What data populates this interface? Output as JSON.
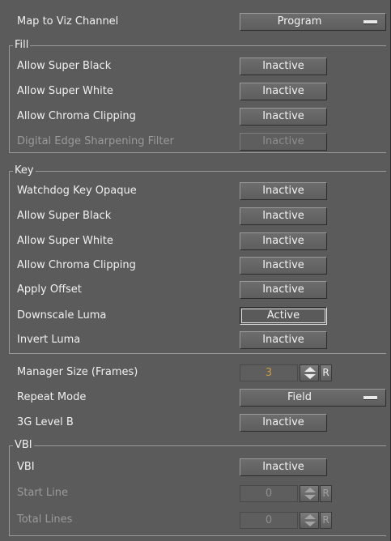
{
  "map_to_viz_channel": {
    "label": "Map to Viz Channel",
    "value": "Program"
  },
  "fill": {
    "title": "Fill",
    "items": [
      {
        "label": "Allow Super Black",
        "value": "Inactive"
      },
      {
        "label": "Allow Super White",
        "value": "Inactive"
      },
      {
        "label": "Allow Chroma Clipping",
        "value": "Inactive"
      },
      {
        "label": "Digital Edge Sharpening Filter",
        "value": "Inactive",
        "disabled": true
      }
    ]
  },
  "key": {
    "title": "Key",
    "items": [
      {
        "label": "Watchdog Key Opaque",
        "value": "Inactive"
      },
      {
        "label": "Allow Super Black",
        "value": "Inactive"
      },
      {
        "label": "Allow Super White",
        "value": "Inactive"
      },
      {
        "label": "Allow Chroma Clipping",
        "value": "Inactive"
      },
      {
        "label": "Apply Offset",
        "value": "Inactive"
      },
      {
        "label": "Downscale Luma",
        "value": "Active",
        "active": true
      },
      {
        "label": "Invert Luma",
        "value": "Inactive"
      }
    ]
  },
  "manager_size": {
    "label": "Manager Size (Frames)",
    "value": "3",
    "reset": "R"
  },
  "repeat_mode": {
    "label": "Repeat Mode",
    "value": "Field"
  },
  "level_b": {
    "label": "3G Level B",
    "value": "Inactive"
  },
  "vbi": {
    "title": "VBI",
    "vbi": {
      "label": "VBI",
      "value": "Inactive"
    },
    "start_line": {
      "label": "Start Line",
      "value": "0",
      "reset": "R"
    },
    "total_lines": {
      "label": "Total Lines",
      "value": "0",
      "reset": "R"
    }
  },
  "colors": {
    "panel_bg": "#5b5b5b",
    "spin_value": "#c79a43",
    "disabled_text": "#9a9a9a"
  }
}
